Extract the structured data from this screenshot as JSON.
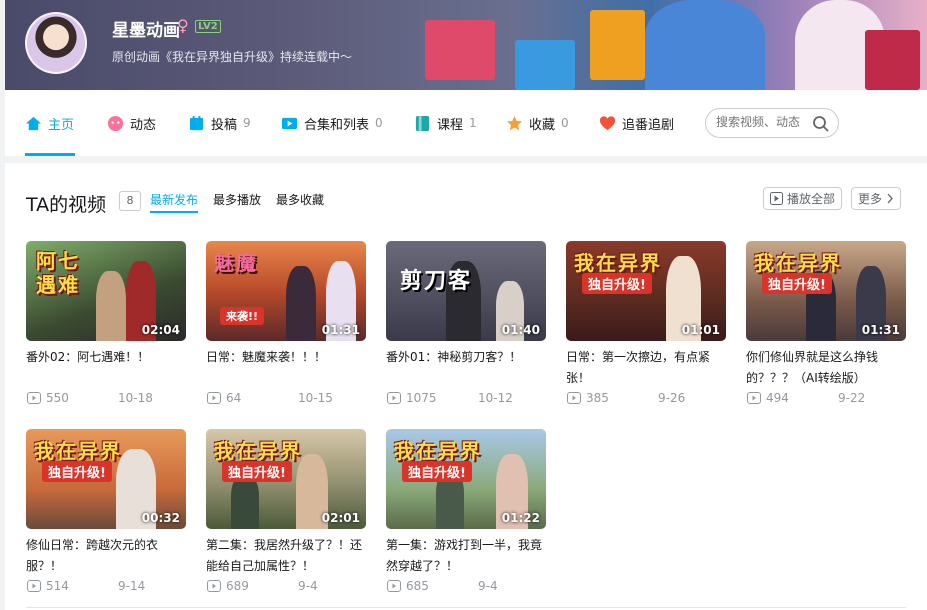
{
  "profile": {
    "username": "星墨动画",
    "gender_symbol": "♀",
    "level": "LV2",
    "signature": "原创动画《我在异界独自升级》持续连载中～"
  },
  "nav": {
    "items": [
      {
        "label": "主页",
        "count": "",
        "icon": "home-icon"
      },
      {
        "label": "动态",
        "count": "",
        "icon": "dynamic-icon"
      },
      {
        "label": "投稿",
        "count": "9",
        "icon": "upload-icon"
      },
      {
        "label": "合集和列表",
        "count": "0",
        "icon": "collection-icon"
      },
      {
        "label": "课程",
        "count": "1",
        "icon": "course-icon"
      },
      {
        "label": "收藏",
        "count": "0",
        "icon": "favorite-icon"
      },
      {
        "label": "追番追剧",
        "count": "",
        "icon": "heart-icon"
      }
    ],
    "search_placeholder": "搜索视频、动态"
  },
  "videos_section": {
    "title": "TA的视频",
    "count": "8",
    "tabs": [
      "最新发布",
      "最多播放",
      "最多收藏"
    ],
    "play_all": "播放全部",
    "more": "更多"
  },
  "videos": [
    {
      "title": "番外02：阿七遇难！！",
      "duration": "02:04",
      "plays": "550",
      "date": "10-18",
      "art_title": "阿七遇难",
      "art_sub": ""
    },
    {
      "title": "日常：魅魔来袭！！！",
      "duration": "01:31",
      "plays": "64",
      "date": "10-15",
      "art_title": "魅魔",
      "art_sub": "来袭!!"
    },
    {
      "title": "番外01：神秘剪刀客？！",
      "duration": "01:40",
      "plays": "1075",
      "date": "10-12",
      "art_title": "剪刀客",
      "art_sub": ""
    },
    {
      "title": "日常：第一次擦边，有点紧张！",
      "duration": "01:01",
      "plays": "385",
      "date": "9-26",
      "art_title": "我在异界",
      "art_sub": "独自升级!"
    },
    {
      "title": "你们修仙界就是这么挣钱的？？？（AI转绘版）",
      "duration": "01:31",
      "plays": "494",
      "date": "9-22",
      "art_title": "我在异界",
      "art_sub": "独自升级!"
    },
    {
      "title": "修仙日常：跨越次元的衣服？！",
      "duration": "00:32",
      "plays": "514",
      "date": "9-14",
      "art_title": "我在异界",
      "art_sub": "独自升级!"
    },
    {
      "title": "第二集：我居然升级了？！还能给自己加属性？！",
      "duration": "02:01",
      "plays": "689",
      "date": "9-4",
      "art_title": "我在异界",
      "art_sub": "独自升级!"
    },
    {
      "title": "第一集：游戏打到一半，我竟然穿越了？！",
      "duration": "01:22",
      "plays": "685",
      "date": "9-4",
      "art_title": "我在异界",
      "art_sub": "独自升级!"
    }
  ],
  "colors": {
    "accent": "#00aeec",
    "muted": "#9499a0"
  }
}
